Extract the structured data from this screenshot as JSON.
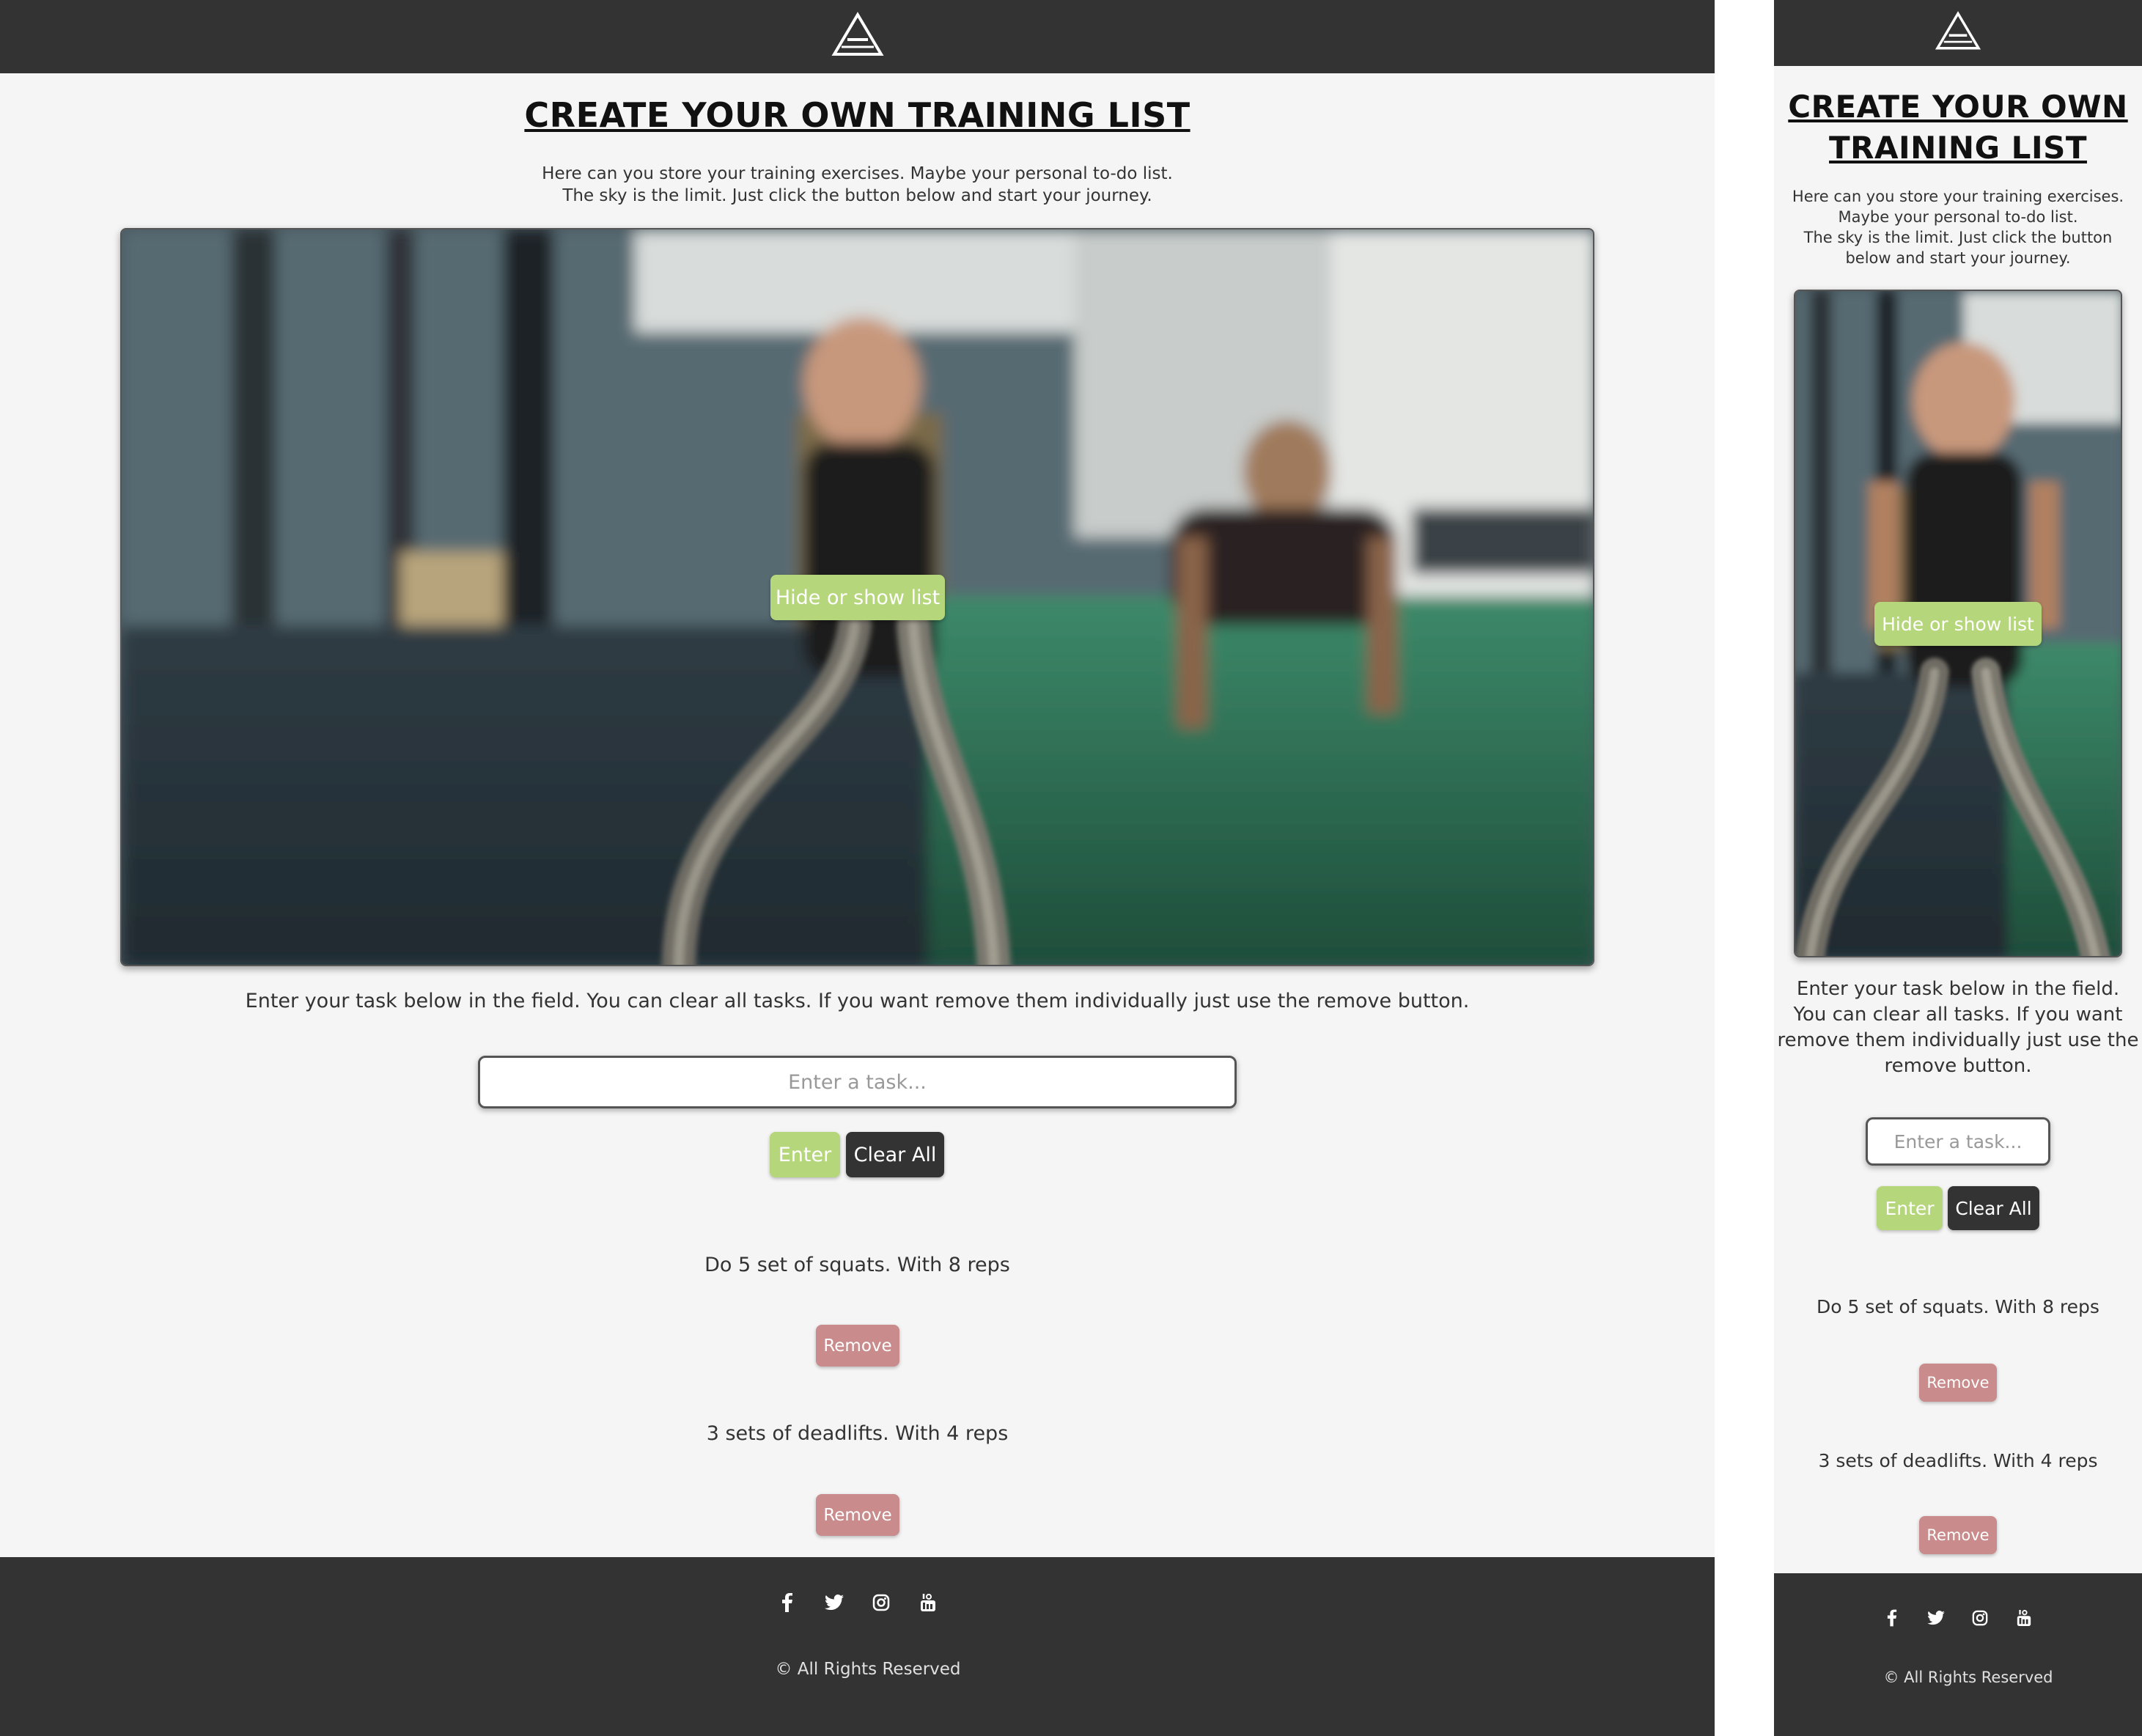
{
  "header": {
    "logo_icon": "triangle-logo-icon"
  },
  "page": {
    "title": "CREATE YOUR OWN TRAINING LIST",
    "intro_line1": "Here can you store your training exercises. Maybe your personal to-do list.",
    "intro_line2": "The sky is the limit. Just click the button below and start your journey.",
    "mobile_title_line1": "CREATE YOUR OWN",
    "mobile_title_line2": "TRAINING LIST",
    "mobile_intro_lines": [
      "Here can you store your training exercises.",
      "Maybe your personal to-do list.",
      "The sky is the limit. Just click the button",
      "below and start your journey."
    ],
    "toggle_button": "Hide or show list",
    "instructions": "Enter your task below in the field. You can clear all tasks. If you want remove them individually just use the remove button.",
    "mobile_instruction_lines": [
      "Enter your task below in the field.",
      "You can clear all tasks. If you want",
      "remove them individually just use the",
      "remove button."
    ],
    "input_placeholder": "Enter a task...",
    "enter_button": "Enter",
    "clear_button": "Clear All"
  },
  "tasks": [
    {
      "text": "Do 5 set of squats. With 8 reps",
      "remove_label": "Remove"
    },
    {
      "text": "3 sets of deadlifts. With 4 reps",
      "remove_label": "Remove"
    }
  ],
  "footer": {
    "social_icons": [
      "facebook-icon",
      "twitter-icon",
      "instagram-icon",
      "youtube-icon"
    ],
    "copyright": "© All Rights Reserved"
  },
  "colors": {
    "nav_bg": "#333333",
    "page_bg": "#f5f5f5",
    "accent_green": "#b5d67a",
    "remove_pink": "#c98b8b"
  }
}
